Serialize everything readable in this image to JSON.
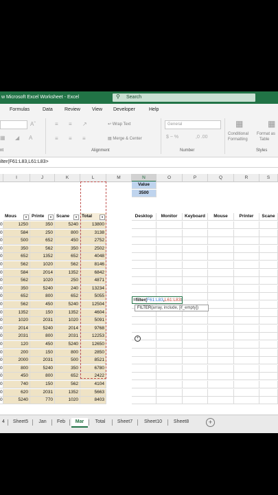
{
  "app": {
    "title": "w Microsoft Excel Worksheet  -  Excel",
    "search_placeholder": "Search",
    "accent": "#217346"
  },
  "menu": [
    "Formulas",
    "Data",
    "Review",
    "View",
    "Developer",
    "Help"
  ],
  "ribbon": {
    "wrap_text": "Wrap Text",
    "merge_center": "Merge & Center",
    "number_format": "General",
    "conditional_formatting": [
      "Conditional",
      "Formatting"
    ],
    "format_as_table": [
      "Format as",
      "Table"
    ],
    "groups": {
      "font_tail": "nt",
      "alignment": "Alignment",
      "number": "Number",
      "styles": "Styles"
    }
  },
  "formula_bar": {
    "text": "ilter(F61:L83,L61:L83>"
  },
  "columns": [
    "I",
    "J",
    "K",
    "L",
    "M",
    "N",
    "O",
    "P",
    "Q",
    "R",
    "S"
  ],
  "left_table": {
    "headers": [
      "Mous",
      "Printe",
      "Scane",
      "Total"
    ],
    "row_stub": "0",
    "rows": [
      [
        "1250",
        "350",
        "5240",
        "13800"
      ],
      [
        "584",
        "250",
        "800",
        "3138"
      ],
      [
        "500",
        "652",
        "450",
        "2752"
      ],
      [
        "350",
        "562",
        "350",
        "2502"
      ],
      [
        "652",
        "1352",
        "652",
        "4048"
      ],
      [
        "562",
        "1020",
        "562",
        "8146"
      ],
      [
        "584",
        "2014",
        "1352",
        "6842"
      ],
      [
        "562",
        "1020",
        "250",
        "4871"
      ],
      [
        "350",
        "5240",
        "240",
        "13234"
      ],
      [
        "652",
        "800",
        "652",
        "5055"
      ],
      [
        "562",
        "450",
        "5240",
        "12504"
      ],
      [
        "1352",
        "150",
        "1352",
        "4604"
      ],
      [
        "1020",
        "2031",
        "1020",
        "5091"
      ],
      [
        "2014",
        "5240",
        "2014",
        "9768"
      ],
      [
        "2031",
        "800",
        "2031",
        "12253"
      ],
      [
        "120",
        "450",
        "5240",
        "12650"
      ],
      [
        "200",
        "150",
        "800",
        "2850"
      ],
      [
        "2000",
        "2031",
        "500",
        "8521"
      ],
      [
        "800",
        "5240",
        "350",
        "6780"
      ],
      [
        "450",
        "800",
        "652",
        "2422"
      ],
      [
        "740",
        "150",
        "562",
        "4104"
      ],
      [
        "620",
        "2031",
        "1352",
        "5663"
      ],
      [
        "5240",
        "770",
        "1020",
        "8403"
      ]
    ]
  },
  "value_box": {
    "label": "Value",
    "value": "3500"
  },
  "right_table": {
    "headers": [
      "Desktop",
      "Monitor",
      "Keyboard",
      "Mouse",
      "Printer",
      "Scane"
    ]
  },
  "active_formula": {
    "prefix": "=filter(",
    "arg1": "F61:L83",
    "sep": ",",
    "arg2": "L61:L83",
    "suffix": ">"
  },
  "tooltip": {
    "fn": "FILTER(",
    "args": "array, include, [if_empty])"
  },
  "tabs": [
    "4",
    "Sheet5",
    "Jan",
    "Feb",
    "Mar",
    "Total",
    "Sheet7",
    "Sheet10",
    "Sheet8"
  ],
  "active_tab": "Mar"
}
